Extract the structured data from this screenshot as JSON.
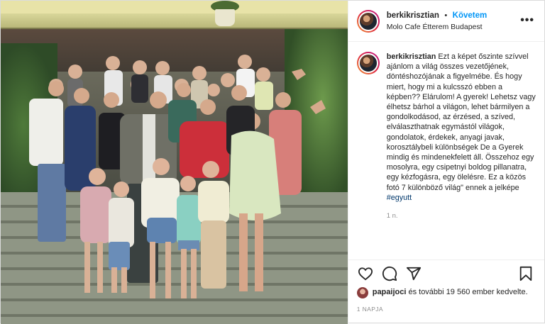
{
  "post": {
    "author": {
      "username": "berkikrisztian",
      "separator": "•",
      "follow_label": "Követem",
      "location": "Molo Cafe Étterem Budapest"
    },
    "more_label": "•••",
    "caption": {
      "username": "berkikrisztian",
      "text": "Ezt a képet őszinte szívvel ajánlom a világ összes vezetőjének, döntéshozójának a figyelmébe. És hogy miert, hogy mi a kulcsszó ebben a képben?? Elárulom! A gyerek! Lehetsz vagy élhetsz bárhol a világon, lehet bármilyen a gondolkodásod, az érzésed, a szíved, elválaszthatnak egymástól világok, gondolatok, érdekek, anyagi javak, korosztálybeli különbségek De a Gyerek mindig és mindenekfelett áll. Összehoz egy mosolyra, egy csipetnyi boldog pillanatra, egy kézfogásra, egy ölelésre. Ez a közös fotó 7 különböző világ\" ennek a jelképe",
      "hashtag": "#egyutt",
      "time_ago": "1 n."
    },
    "icons": {
      "like": "heart-icon",
      "comment": "comment-icon",
      "share": "share-icon",
      "save": "bookmark-icon"
    },
    "likes": {
      "first_user": "papaijoci",
      "rest_text": " és további 19 560 ember kedvelte."
    },
    "date_label": "1 NAPJA"
  }
}
